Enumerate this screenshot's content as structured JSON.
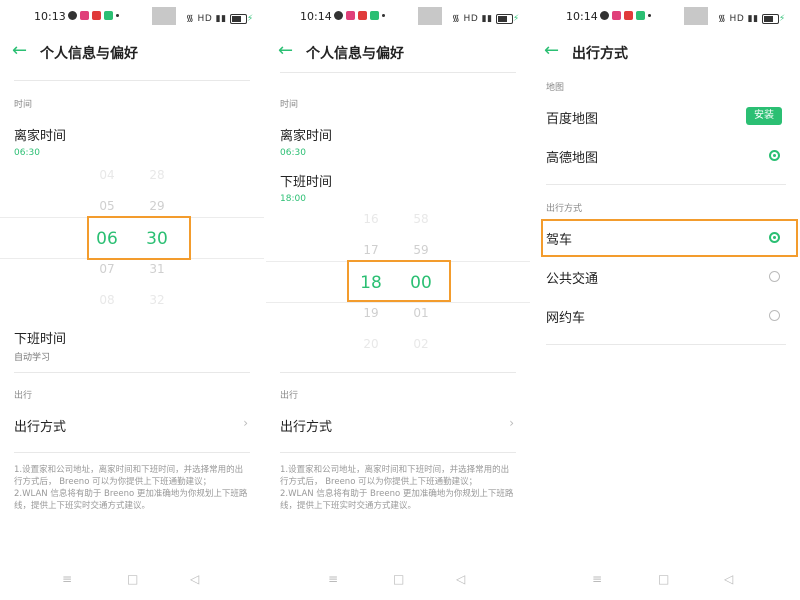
{
  "colors": {
    "accent": "#2bbf73",
    "highlight": "#f39c2d"
  },
  "icons": {
    "back": "arrow-left-icon",
    "chevron": "chevron-right-icon",
    "nav_menu": "menu-icon",
    "nav_home": "home-square-icon",
    "nav_back": "back-triangle-icon"
  },
  "nav": {
    "menu": "≡",
    "home": "□",
    "back": "◁"
  },
  "screen1": {
    "time": "10:13",
    "status_right": "HD",
    "title": "个人信息与偏好",
    "time_section": "时间",
    "leave_home": {
      "label": "离家时间",
      "value": "06:30"
    },
    "picker": {
      "hours": [
        "04",
        "05",
        "06",
        "07",
        "08"
      ],
      "minutes": [
        "28",
        "29",
        "30",
        "31",
        "32"
      ]
    },
    "off_work": {
      "label": "下班时间",
      "value": "自动学习"
    },
    "travel_section": "出行",
    "travel_mode": "出行方式",
    "note": "1.设置家和公司地址，离家时间和下班时间，并选择常用的出行方式后， Breeno 可以为你提供上下班通勤建议；\n2.WLAN 信息将有助于 Breeno 更加准确地为你规划上下班路线，提供上下班实时交通方式建议。"
  },
  "screen2": {
    "time": "10:14",
    "status_right": "HD",
    "title": "个人信息与偏好",
    "time_section": "时间",
    "leave_home": {
      "label": "离家时间",
      "value": "06:30"
    },
    "off_work": {
      "label": "下班时间",
      "value": "18:00"
    },
    "picker": {
      "hours": [
        "16",
        "17",
        "18",
        "19",
        "20"
      ],
      "minutes": [
        "58",
        "59",
        "00",
        "01",
        "02"
      ]
    },
    "travel_section": "出行",
    "travel_mode": "出行方式",
    "note": "1.设置家和公司地址，离家时间和下班时间，并选择常用的出行方式后， Breeno 可以为你提供上下班通勤建议；\n2.WLAN 信息将有助于 Breeno 更加准确地为你规划上下班路线，提供上下班实时交通方式建议。"
  },
  "screen3": {
    "time": "10:14",
    "status_right": "HD",
    "title": "出行方式",
    "map_section": "地图",
    "maps": [
      {
        "label": "百度地图",
        "action": "安装"
      },
      {
        "label": "高德地图",
        "selected": true
      }
    ],
    "mode_section": "出行方式",
    "modes": [
      {
        "label": "驾车",
        "selected": true
      },
      {
        "label": "公共交通",
        "selected": false
      },
      {
        "label": "网约车",
        "selected": false
      }
    ]
  }
}
